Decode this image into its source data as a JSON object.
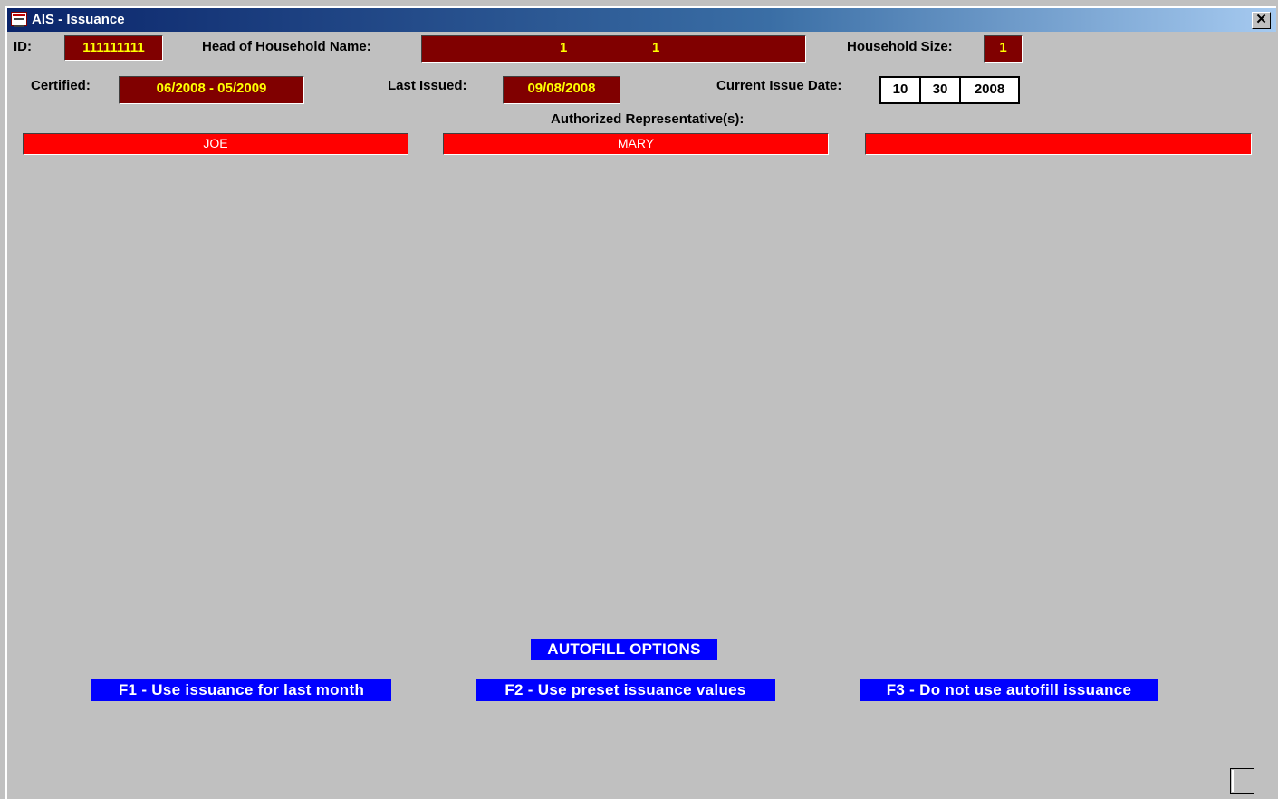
{
  "window": {
    "title": "AIS - Issuance",
    "icon": "window-app-icon",
    "close_label": "✕"
  },
  "header": {
    "id_label": "ID:",
    "id_value": "111111111",
    "hoh_label": "Head of Household Name:",
    "hoh_first": "1",
    "hoh_last": "1",
    "household_size_label": "Household Size:",
    "household_size_value": "1",
    "certified_label": "Certified:",
    "certified_value": "06/2008 - 05/2009",
    "last_issued_label": "Last Issued:",
    "last_issued_value": "09/08/2008",
    "current_issue_label": "Current Issue Date:",
    "current_issue_month": "10",
    "current_issue_day": "30",
    "current_issue_year": "2008"
  },
  "representatives": {
    "label": "Authorized Representative(s):",
    "names": [
      "JOE",
      "MARY",
      ""
    ]
  },
  "autofill": {
    "title": "AUTOFILL OPTIONS",
    "options": [
      "F1 - Use issuance for last month",
      "F2 - Use preset issuance values",
      "F3 - Do not use autofill issuance"
    ]
  },
  "colors": {
    "background": "#c0c0c0",
    "field_dark": "#800000",
    "field_text": "#ffff00",
    "rep_field": "#ff0000",
    "autofill_bg": "#0000ff",
    "titlebar_start": "#0a246a"
  }
}
